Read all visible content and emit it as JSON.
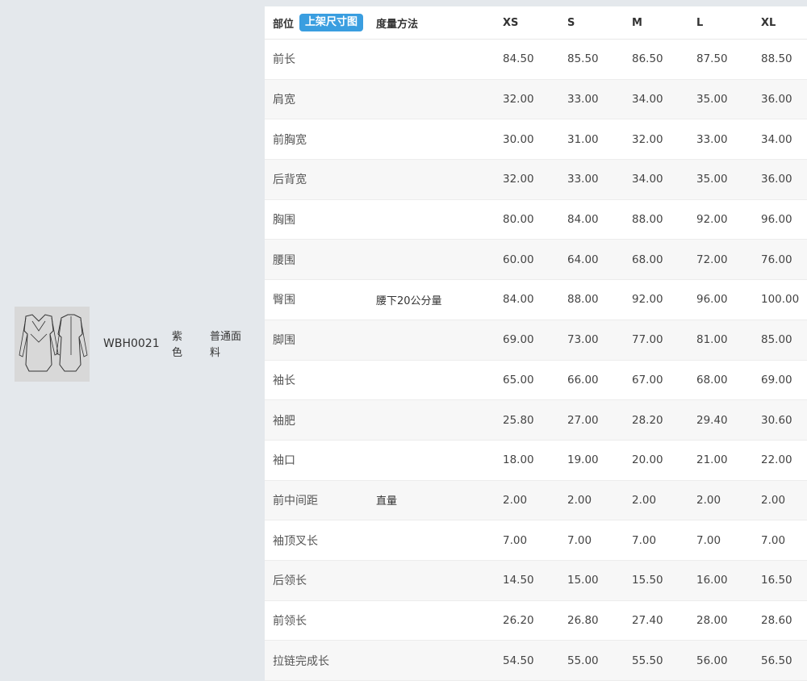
{
  "product": {
    "style_code": "WBH0021",
    "color": "紫色",
    "fabric": "普通面料"
  },
  "table": {
    "header": {
      "part": "部位",
      "badge": "上架尺寸图",
      "method": "度量方法",
      "sizes": [
        "XS",
        "S",
        "M",
        "L",
        "XL"
      ]
    },
    "rows": [
      {
        "part": "前长",
        "method": "",
        "values": [
          "84.50",
          "85.50",
          "86.50",
          "87.50",
          "88.50"
        ]
      },
      {
        "part": "肩宽",
        "method": "",
        "values": [
          "32.00",
          "33.00",
          "34.00",
          "35.00",
          "36.00"
        ]
      },
      {
        "part": "前胸宽",
        "method": "",
        "values": [
          "30.00",
          "31.00",
          "32.00",
          "33.00",
          "34.00"
        ]
      },
      {
        "part": "后背宽",
        "method": "",
        "values": [
          "32.00",
          "33.00",
          "34.00",
          "35.00",
          "36.00"
        ]
      },
      {
        "part": "胸围",
        "method": "",
        "values": [
          "80.00",
          "84.00",
          "88.00",
          "92.00",
          "96.00"
        ]
      },
      {
        "part": "腰围",
        "method": "",
        "values": [
          "60.00",
          "64.00",
          "68.00",
          "72.00",
          "76.00"
        ]
      },
      {
        "part": "臀围",
        "method": "腰下20公分量",
        "values": [
          "84.00",
          "88.00",
          "92.00",
          "96.00",
          "100.00"
        ]
      },
      {
        "part": "脚围",
        "method": "",
        "values": [
          "69.00",
          "73.00",
          "77.00",
          "81.00",
          "85.00"
        ]
      },
      {
        "part": "袖长",
        "method": "",
        "values": [
          "65.00",
          "66.00",
          "67.00",
          "68.00",
          "69.00"
        ]
      },
      {
        "part": "袖肥",
        "method": "",
        "values": [
          "25.80",
          "27.00",
          "28.20",
          "29.40",
          "30.60"
        ]
      },
      {
        "part": "袖口",
        "method": "",
        "values": [
          "18.00",
          "19.00",
          "20.00",
          "21.00",
          "22.00"
        ]
      },
      {
        "part": "前中间距",
        "method": "直量",
        "values": [
          "2.00",
          "2.00",
          "2.00",
          "2.00",
          "2.00"
        ]
      },
      {
        "part": "袖顶叉长",
        "method": "",
        "values": [
          "7.00",
          "7.00",
          "7.00",
          "7.00",
          "7.00"
        ]
      },
      {
        "part": "后领长",
        "method": "",
        "values": [
          "14.50",
          "15.00",
          "15.50",
          "16.00",
          "16.50"
        ]
      },
      {
        "part": "前领长",
        "method": "",
        "values": [
          "26.20",
          "26.80",
          "27.40",
          "28.00",
          "28.60"
        ]
      },
      {
        "part": "拉链完成长",
        "method": "",
        "values": [
          "54.50",
          "55.00",
          "55.50",
          "56.00",
          "56.50"
        ]
      }
    ]
  },
  "colors": {
    "badge": "#3a9ee0",
    "page_bg": "#e4e8ec",
    "row_alt": "#f7f7f7"
  }
}
